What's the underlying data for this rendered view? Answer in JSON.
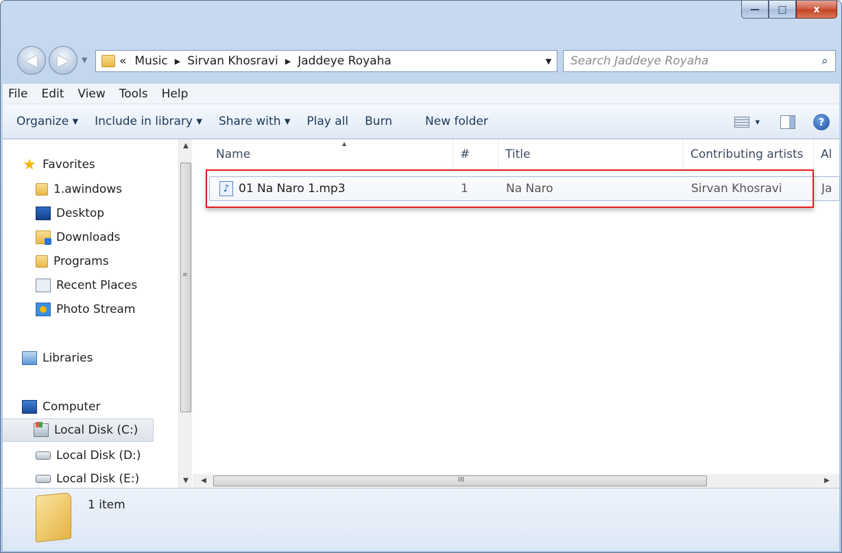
{
  "window": {
    "caption_buttons": {
      "minimize": "—",
      "maximize": "□",
      "close": "x"
    }
  },
  "address": {
    "overflow": "«",
    "crumbs": [
      "Music",
      "Sirvan Khosravi",
      "Jaddeye Royaha"
    ]
  },
  "search": {
    "placeholder": "Search Jaddeye Royaha"
  },
  "menu": [
    "File",
    "Edit",
    "View",
    "Tools",
    "Help"
  ],
  "toolbar": {
    "organize": "Organize ▾",
    "include": "Include in library ▾",
    "share": "Share with ▾",
    "play_all": "Play all",
    "burn": "Burn",
    "new_folder": "New folder",
    "view_dropdown": "▾"
  },
  "nav": {
    "favorites": "Favorites",
    "awindows": "1.awindows",
    "desktop": "Desktop",
    "downloads": "Downloads",
    "programs": "Programs",
    "recent": "Recent Places",
    "photo": "Photo Stream",
    "libraries": "Libraries",
    "computer": "Computer",
    "disk_c": "Local Disk (C:)",
    "disk_d": "Local Disk (D:)",
    "disk_e": "Local Disk (E:)"
  },
  "columns": {
    "name": "Name",
    "number": "#",
    "title": "Title",
    "artists": "Contributing artists",
    "album_partial": "Al"
  },
  "file": {
    "name": "01 Na Naro 1.mp3",
    "number": "1",
    "title": "Na Naro",
    "artist": "Sirvan Khosravi",
    "album_partial": "Ja"
  },
  "status": {
    "count": "1 item"
  },
  "icons": {
    "music_note": "♪",
    "star": "★",
    "search": "⌕",
    "help": "?",
    "back": "◀",
    "forward": "▶",
    "refresh": "⟲",
    "crumb_sep": "▶",
    "grip_h": "III",
    "scroll_up": "▲",
    "scroll_down": "▼",
    "scroll_left": "◀",
    "scroll_right": "▶"
  },
  "colors": {
    "highlight": "#e51a1a"
  }
}
